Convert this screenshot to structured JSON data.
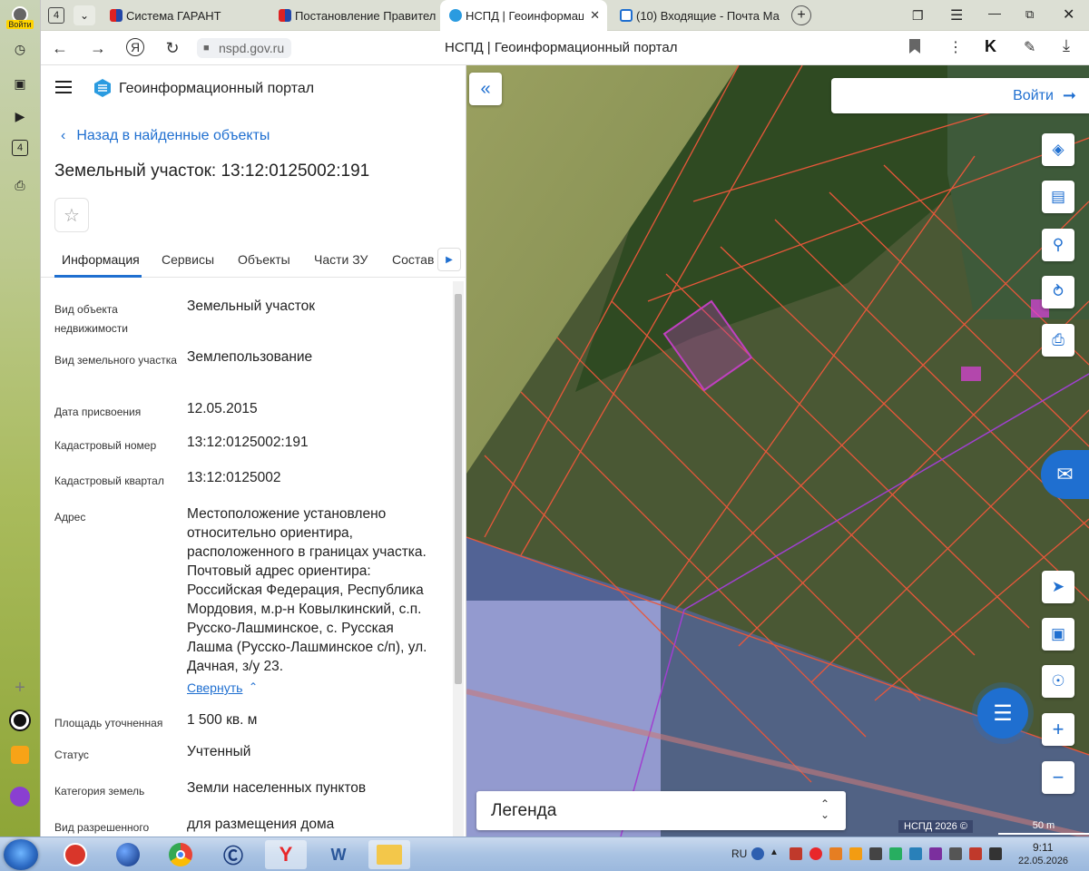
{
  "browser": {
    "tab_count_badge": "4",
    "tabs": [
      {
        "title": "Система ГАРАНТ",
        "active": false
      },
      {
        "title": "Постановление Правител",
        "active": false
      },
      {
        "title": "НСПД | Геоинформаци",
        "active": true
      },
      {
        "title": "(10) Входящие - Почта Ма",
        "active": false
      }
    ],
    "url": "nspd.gov.ru",
    "page_title": "НСПД | Геоинформационный портал",
    "login_label": "Войти"
  },
  "portal": {
    "name": "Геоинформационный портал",
    "back_link": "Назад в найденные объекты",
    "object_title": "Земельный участок: 13:12:0125002:191",
    "tabs": [
      "Информация",
      "Сервисы",
      "Объекты",
      "Части ЗУ",
      "Состав"
    ],
    "properties": [
      {
        "label": "Вид объекта недвижимости",
        "value": "Земельный участок"
      },
      {
        "label": "Вид земельного участка",
        "value": "Землепользование"
      },
      {
        "label": "Дата присвоения",
        "value": "12.05.2015"
      },
      {
        "label": "Кадастровый номер",
        "value": "13:12:0125002:191"
      },
      {
        "label": "Кадастровый квартал",
        "value": "13:12:0125002"
      },
      {
        "label": "Адрес",
        "value": "Местоположение установлено относительно ориентира, расположенного в границах участка. Почтовый адрес ориентира: Российская Федерация, Республика Мордовия, м.р-н Ковылкинский, с.п. Русско-Лашминское, с. Русская Лашма (Русско-Лашминское с/п), ул. Дачная, з/у 23."
      },
      {
        "label": "Площадь уточненная",
        "value": "1 500 кв. м"
      },
      {
        "label": "Статус",
        "value": "Учтенный"
      },
      {
        "label": "Категория земель",
        "value": "Земли населенных пунктов"
      },
      {
        "label": "Вид разрешенного",
        "value": "для размещения дома"
      }
    ],
    "collapse_label": "Свернуть"
  },
  "map": {
    "login_label": "Войти",
    "legend_label": "Легенда",
    "attribution": "НСПД 2026 ©",
    "scale_label": "50 m",
    "colors": {
      "accent": "#1f6fd0",
      "parcel_line": "#e8573a",
      "selected_parcel": "#c040c0",
      "zone_overlay": "#5a6ee6"
    }
  },
  "taskbar": {
    "language": "RU",
    "time": "9:11",
    "date": "22.05.2026"
  }
}
